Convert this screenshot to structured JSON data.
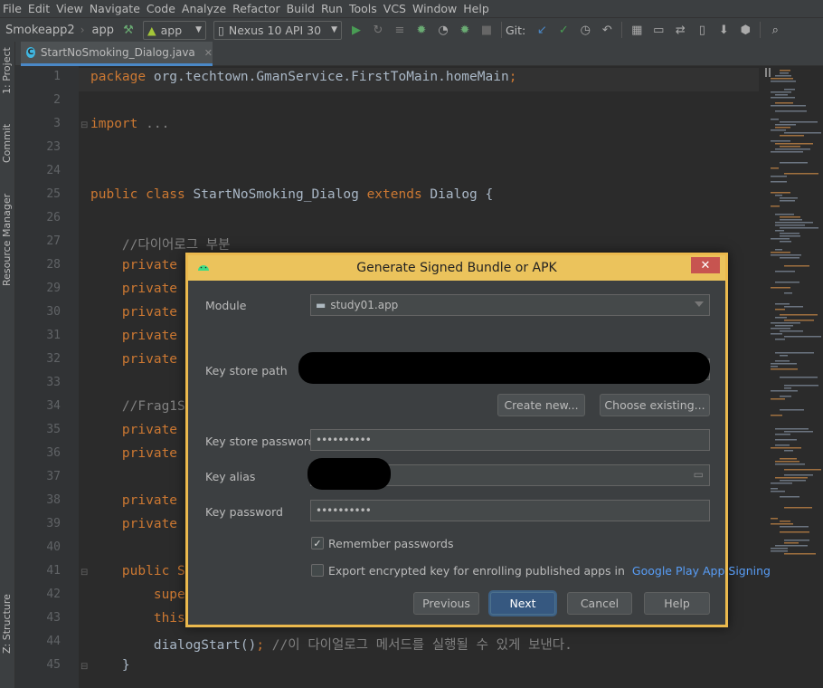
{
  "menu": [
    "File",
    "Edit",
    "View",
    "Navigate",
    "Code",
    "Analyze",
    "Refactor",
    "Build",
    "Run",
    "Tools",
    "VCS",
    "Window",
    "Help"
  ],
  "toolbar": {
    "project": "Smokeapp2",
    "module": "app",
    "run_config": "app",
    "device": "Nexus 10 API 30",
    "git_label": "Git:"
  },
  "side_panels": {
    "project": "1: Project",
    "commit": "Commit",
    "resource_manager": "Resource Manager",
    "structure": "Z: Structure"
  },
  "editor": {
    "tab": "StartNoSmoking_Dialog.java",
    "lines": [
      {
        "no": "1",
        "segments": [
          {
            "t": "package ",
            "c": "kw"
          },
          {
            "t": "org.techtown.GmanService.FirstToMain.homeMain",
            "c": ""
          },
          {
            "t": ";",
            "c": "kw"
          }
        ]
      },
      {
        "no": "2",
        "segments": []
      },
      {
        "no": "3",
        "segments": [
          {
            "t": "import ",
            "c": "kw"
          },
          {
            "t": "...",
            "c": "cm"
          }
        ]
      },
      {
        "no": "23",
        "segments": []
      },
      {
        "no": "24",
        "segments": []
      },
      {
        "no": "25",
        "segments": [
          {
            "t": "public class ",
            "c": "kw"
          },
          {
            "t": "StartNoSmoking_Dialog ",
            "c": ""
          },
          {
            "t": "extends ",
            "c": "kw"
          },
          {
            "t": "Dialog {",
            "c": ""
          }
        ]
      },
      {
        "no": "26",
        "segments": []
      },
      {
        "no": "27",
        "segments": [
          {
            "t": "    //다이어로그 부분",
            "c": "cm"
          }
        ]
      },
      {
        "no": "28",
        "segments": [
          {
            "t": "    private",
            "c": "kw"
          }
        ]
      },
      {
        "no": "29",
        "segments": [
          {
            "t": "    private",
            "c": "kw"
          }
        ]
      },
      {
        "no": "30",
        "segments": [
          {
            "t": "    private",
            "c": "kw"
          }
        ]
      },
      {
        "no": "31",
        "segments": [
          {
            "t": "    private",
            "c": "kw"
          }
        ]
      },
      {
        "no": "32",
        "segments": [
          {
            "t": "    private",
            "c": "kw"
          }
        ]
      },
      {
        "no": "33",
        "segments": []
      },
      {
        "no": "34",
        "segments": [
          {
            "t": "    //Frag1S",
            "c": "cm"
          }
        ]
      },
      {
        "no": "35",
        "segments": [
          {
            "t": "    private",
            "c": "kw"
          }
        ]
      },
      {
        "no": "36",
        "segments": [
          {
            "t": "    private",
            "c": "kw"
          }
        ]
      },
      {
        "no": "37",
        "segments": []
      },
      {
        "no": "38",
        "segments": [
          {
            "t": "    private",
            "c": "kw"
          }
        ]
      },
      {
        "no": "39",
        "segments": [
          {
            "t": "    private",
            "c": "kw"
          }
        ]
      },
      {
        "no": "40",
        "segments": []
      },
      {
        "no": "41",
        "segments": [
          {
            "t": "    public S",
            "c": "kw"
          }
        ]
      },
      {
        "no": "42",
        "segments": [
          {
            "t": "        supe",
            "c": "kw"
          }
        ]
      },
      {
        "no": "43",
        "segments": [
          {
            "t": "        this",
            "c": "kw"
          }
        ]
      },
      {
        "no": "44",
        "segments": [
          {
            "t": "        dialogStart()",
            "c": ""
          },
          {
            "t": "; ",
            "c": "kw"
          },
          {
            "t": "//이 다이얼로그 메서드를 실행될 수 있게 보낸다.",
            "c": "cm"
          }
        ]
      },
      {
        "no": "45",
        "segments": [
          {
            "t": "    }",
            "c": ""
          }
        ]
      }
    ]
  },
  "dialog": {
    "title": "Generate Signed Bundle or APK",
    "module_label": "Module",
    "module_value": "study01.app",
    "key_store_path_label": "Key store path",
    "create_new": "Create new...",
    "choose_existing": "Choose existing...",
    "key_store_password_label": "Key store password",
    "key_store_password_value": "••••••••••",
    "key_alias_label": "Key alias",
    "key_password_label": "Key password",
    "key_password_value": "••••••••••",
    "remember_passwords": "Remember passwords",
    "remember_checked": true,
    "export_encrypted": "Export encrypted key for enrolling published apps in",
    "export_link": "Google Play App Signing",
    "export_checked": false,
    "buttons": {
      "previous": "Previous",
      "next": "Next",
      "cancel": "Cancel",
      "help": "Help"
    }
  }
}
